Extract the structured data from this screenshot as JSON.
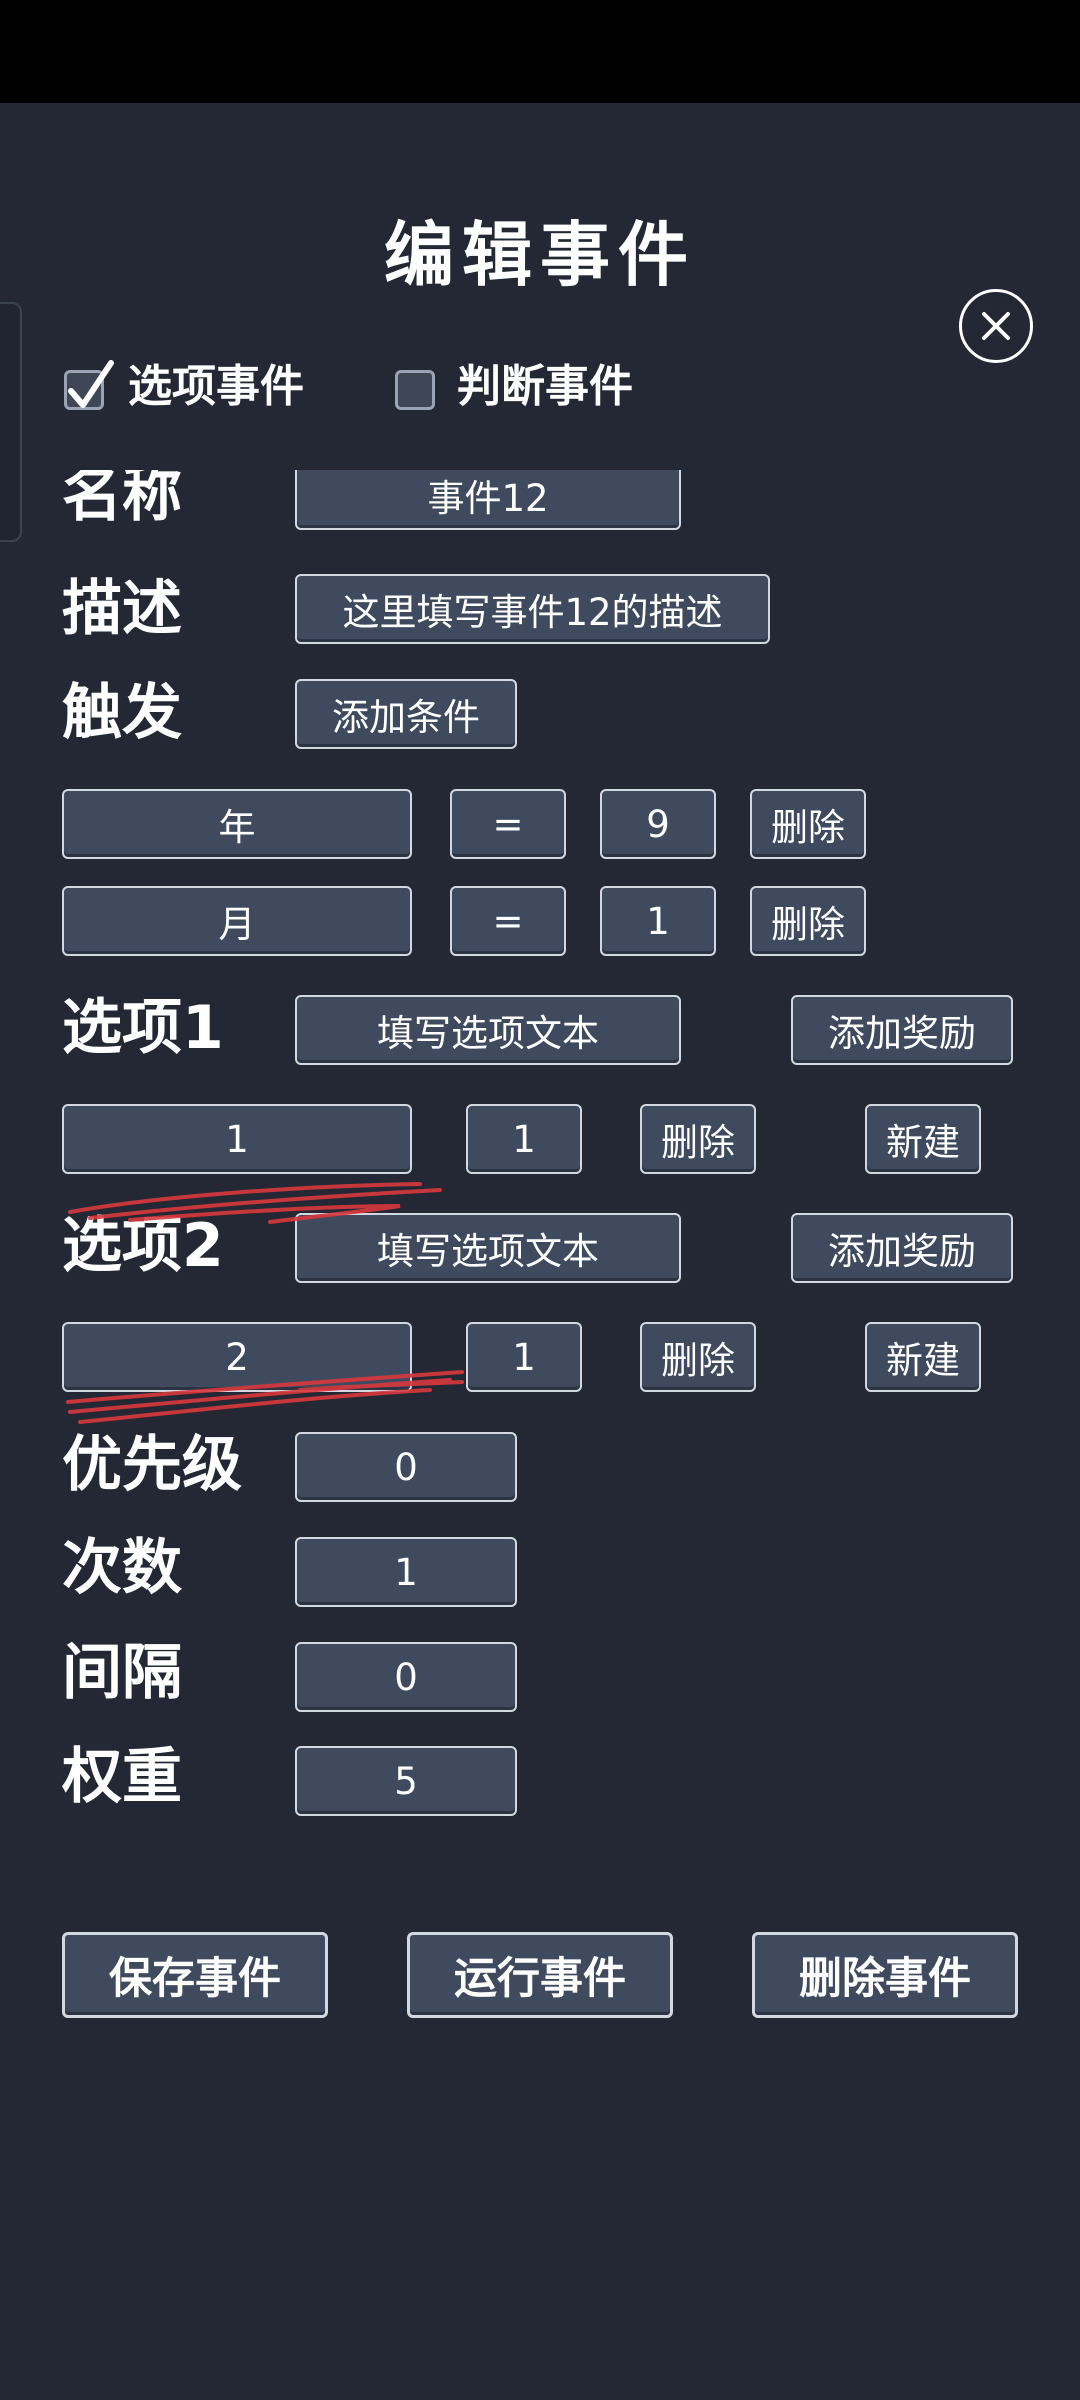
{
  "title": "编辑事件",
  "checkboxes": {
    "option_event": {
      "label": "选项事件",
      "checked": true
    },
    "judge_event": {
      "label": "判断事件",
      "checked": false
    }
  },
  "name": {
    "label": "名称",
    "value": "事件12"
  },
  "description": {
    "label": "描述",
    "value": "这里填写事件12的描述"
  },
  "trigger": {
    "label": "触发",
    "add_button": "添加条件"
  },
  "conditions": [
    {
      "field": "年",
      "operator": "=",
      "value": "9",
      "delete": "删除"
    },
    {
      "field": "月",
      "operator": "=",
      "value": "1",
      "delete": "删除"
    }
  ],
  "options": [
    {
      "label": "选项1",
      "text_placeholder": "填写选项文本",
      "add_reward": "添加奖励",
      "reward": {
        "id": "1",
        "amount": "1",
        "delete": "删除",
        "new": "新建"
      }
    },
    {
      "label": "选项2",
      "text_placeholder": "填写选项文本",
      "add_reward": "添加奖励",
      "reward": {
        "id": "2",
        "amount": "1",
        "delete": "删除",
        "new": "新建"
      }
    }
  ],
  "priority": {
    "label": "优先级",
    "value": "0"
  },
  "count": {
    "label": "次数",
    "value": "1"
  },
  "interval": {
    "label": "间隔",
    "value": "0"
  },
  "weight": {
    "label": "权重",
    "value": "5"
  },
  "actions": {
    "save": "保存事件",
    "run": "运行事件",
    "delete": "删除事件"
  },
  "colors": {
    "background": "#232834",
    "button": "#3f4a5f",
    "button_border": "#d3d8e0",
    "scribble": "#d8373c"
  }
}
